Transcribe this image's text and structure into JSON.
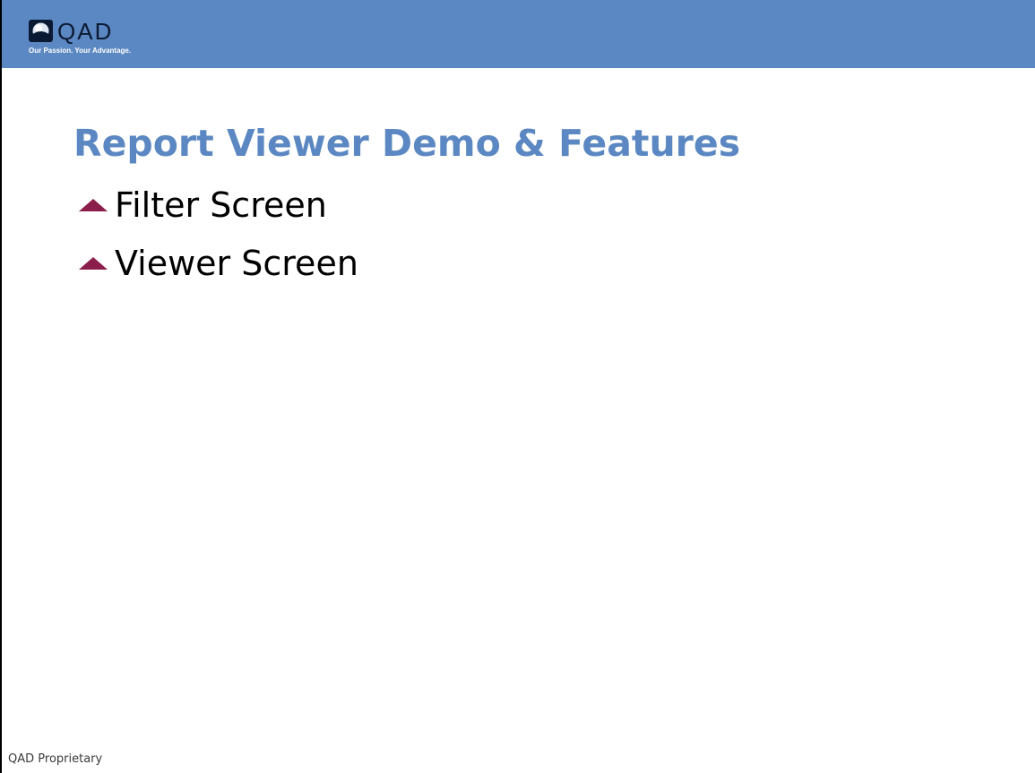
{
  "header": {
    "logo": {
      "icon": "qad-globe-logo-icon",
      "wordmark": "QAD",
      "tagline": "Our Passion. Your Advantage."
    },
    "bar_color": "#5b88c2"
  },
  "slide": {
    "title": "Report Viewer Demo & Features",
    "bullets": [
      {
        "icon": "triangle-bullet-icon",
        "label": "Filter Screen"
      },
      {
        "icon": "triangle-bullet-icon",
        "label": "Viewer Screen"
      }
    ],
    "title_color": "#5b88c2",
    "bullet_color": "#8a1d4a"
  },
  "footer": {
    "text": "QAD Proprietary"
  }
}
